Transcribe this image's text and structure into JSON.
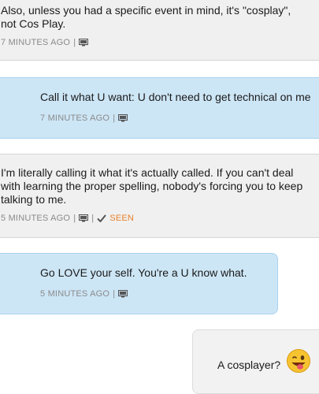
{
  "messages": [
    {
      "line1": "Also, unless you had a specific event in mind, it's \"cosplay\",",
      "line2": "not Cos Play.",
      "time": "7 MINUTES AGO"
    },
    {
      "text": "Call it what U want: U don't need to get technical on me",
      "time": "7 MINUTES AGO"
    },
    {
      "line1": "I'm literally calling it what it's actually called. If you can't deal",
      "line2": "with learning the proper spelling, nobody's forcing you to keep",
      "line3": "talking to me.",
      "time": "5 MINUTES AGO",
      "seen": "SEEN"
    },
    {
      "text": "Go LOVE your self. You're a U know what.",
      "time": "5 MINUTES AGO"
    },
    {
      "text": "A cosplayer?"
    }
  ],
  "separator": "|",
  "icons": {
    "device": "monitor-icon",
    "seen": "check-icon",
    "emoji": "winking-tongue-emoji"
  },
  "colors": {
    "blue_bubble": "#cde6f6",
    "seen_orange": "#e8822e"
  }
}
